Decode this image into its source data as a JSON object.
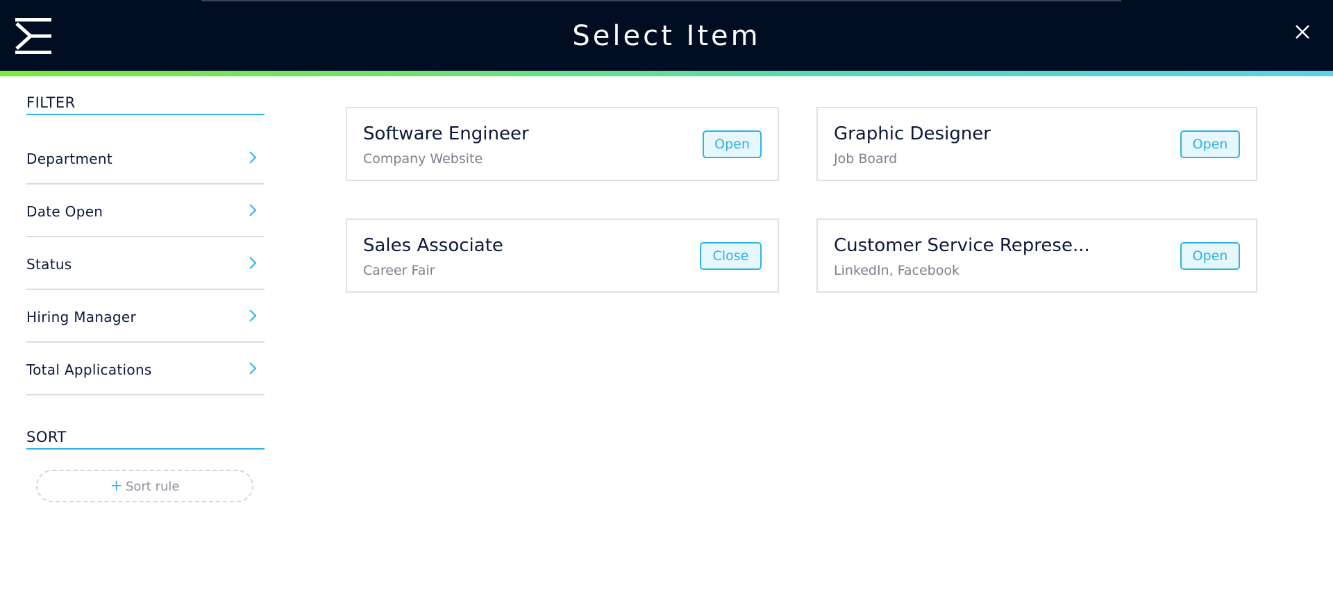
{
  "header": {
    "title": "Select Item",
    "logo_icon": "menu-logo-icon",
    "close_icon": "close-icon",
    "background": "#010d22"
  },
  "sidebar": {
    "filter_heading": "FILTER",
    "filters": [
      {
        "label": "Department"
      },
      {
        "label": "Date Open"
      },
      {
        "label": "Status"
      },
      {
        "label": "Hiring Manager"
      },
      {
        "label": "Total Applications"
      }
    ],
    "sort_heading": "SORT",
    "sort_rule_label": "Sort rule"
  },
  "items": [
    {
      "title": "Software Engineer",
      "source": "Company Website",
      "status": "Open"
    },
    {
      "title": "Graphic Designer",
      "source": "Job Board",
      "status": "Open"
    },
    {
      "title": "Sales Associate",
      "source": "Career Fair",
      "status": "Close"
    },
    {
      "title": "Customer Service Represe...",
      "source": "LinkedIn, Facebook",
      "status": "Open"
    }
  ],
  "colors": {
    "accent": "#2bb3e8",
    "text_dark": "#0b1a3a",
    "text_muted": "#7a808c",
    "gradient_start": "#7ee83a",
    "gradient_end": "#5ed0e8"
  }
}
